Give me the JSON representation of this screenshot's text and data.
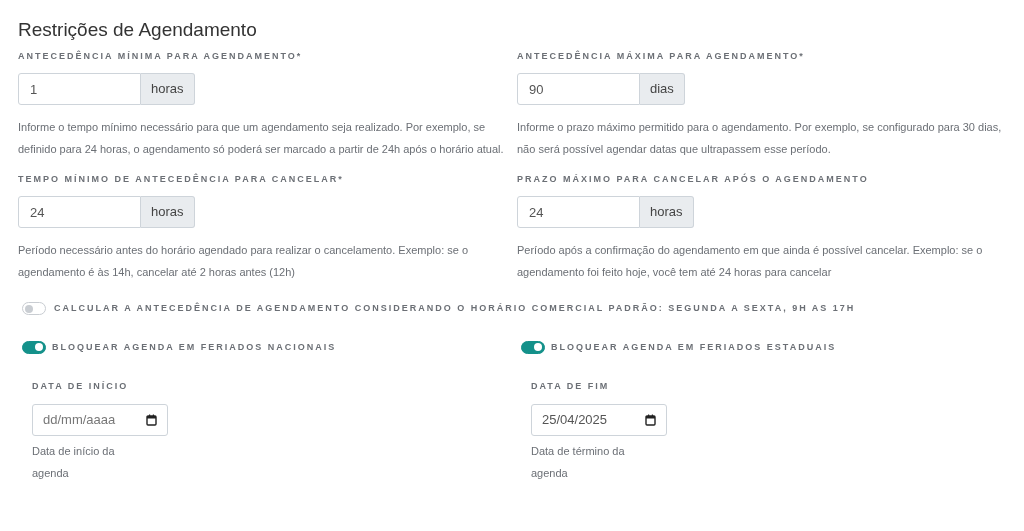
{
  "title": "Restrições de Agendamento",
  "fields": [
    {
      "label": "ANTECEDÊNCIA MÍNIMA PARA AGENDAMENTO*",
      "value": "1",
      "unit": "horas",
      "help": "Informe o tempo mínimo necessário para que um agendamento seja realizado. Por exemplo, se definido para 24 horas, o agendamento só poderá ser marcado a partir de 24h após o horário atual."
    },
    {
      "label": "ANTECEDÊNCIA MÁXIMA PARA AGENDAMENTO*",
      "value": "90",
      "unit": "dias",
      "help": "Informe o prazo máximo permitido para o agendamento. Por exemplo, se configurado para 30 dias, não será possível agendar datas que ultrapassem esse período."
    },
    {
      "label": "TEMPO MÍNIMO DE ANTECEDÊNCIA PARA CANCELAR*",
      "value": "24",
      "unit": "horas",
      "help": "Período necessário antes do horário agendado para realizar o cancelamento. Exemplo: se o agendamento é às 14h, cancelar até 2 horas antes (12h)"
    },
    {
      "label": "PRAZO MÁXIMO PARA CANCELAR APÓS O AGENDAMENTO",
      "value": "24",
      "unit": "horas",
      "help": "Período após a confirmação do agendamento em que ainda é possível cancelar. Exemplo: se o agendamento foi feito hoje, você tem até 24 horas para cancelar"
    }
  ],
  "business_hours_toggle": {
    "label": "CALCULAR A ANTECEDÊNCIA DE AGENDAMENTO CONSIDERANDO O HORÁRIO COMERCIAL PADRÃO: SEGUNDA A SEXTA, 9H AS 17H",
    "on": false
  },
  "holiday_blocks": [
    {
      "label": "BLOQUEAR AGENDA EM FERIADOS NACIONAIS",
      "on": true,
      "date_label": "DATA DE INÍCIO",
      "placeholder": "dd/mm/aaaa",
      "help": "Data de início da agenda"
    },
    {
      "label": "BLOQUEAR AGENDA EM FERIADOS ESTADUAIS",
      "on": true,
      "date_label": "DATA DE FIM",
      "value": "25/04/2025",
      "help": "Data de término da agenda"
    }
  ]
}
